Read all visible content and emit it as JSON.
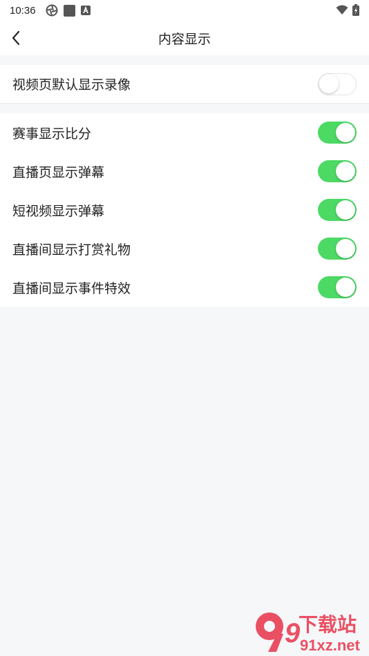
{
  "status_bar": {
    "time": "10:36"
  },
  "header": {
    "title": "内容显示"
  },
  "group1": [
    {
      "label": "视频页默认显示录像",
      "enabled": false
    }
  ],
  "group2": [
    {
      "label": "赛事显示比分",
      "enabled": true
    },
    {
      "label": "直播页显示弹幕",
      "enabled": true
    },
    {
      "label": "短视频显示弹幕",
      "enabled": true
    },
    {
      "label": "直播间显示打赏礼物",
      "enabled": true
    },
    {
      "label": "直播间显示事件特效",
      "enabled": true
    }
  ],
  "colors": {
    "toggle_on": "#4cd964",
    "background": "#f6f7f9",
    "watermark_red": "#e8334a"
  },
  "watermark": {
    "logo_text": "9",
    "brand": "下载站",
    "domain": "91xz.net"
  }
}
